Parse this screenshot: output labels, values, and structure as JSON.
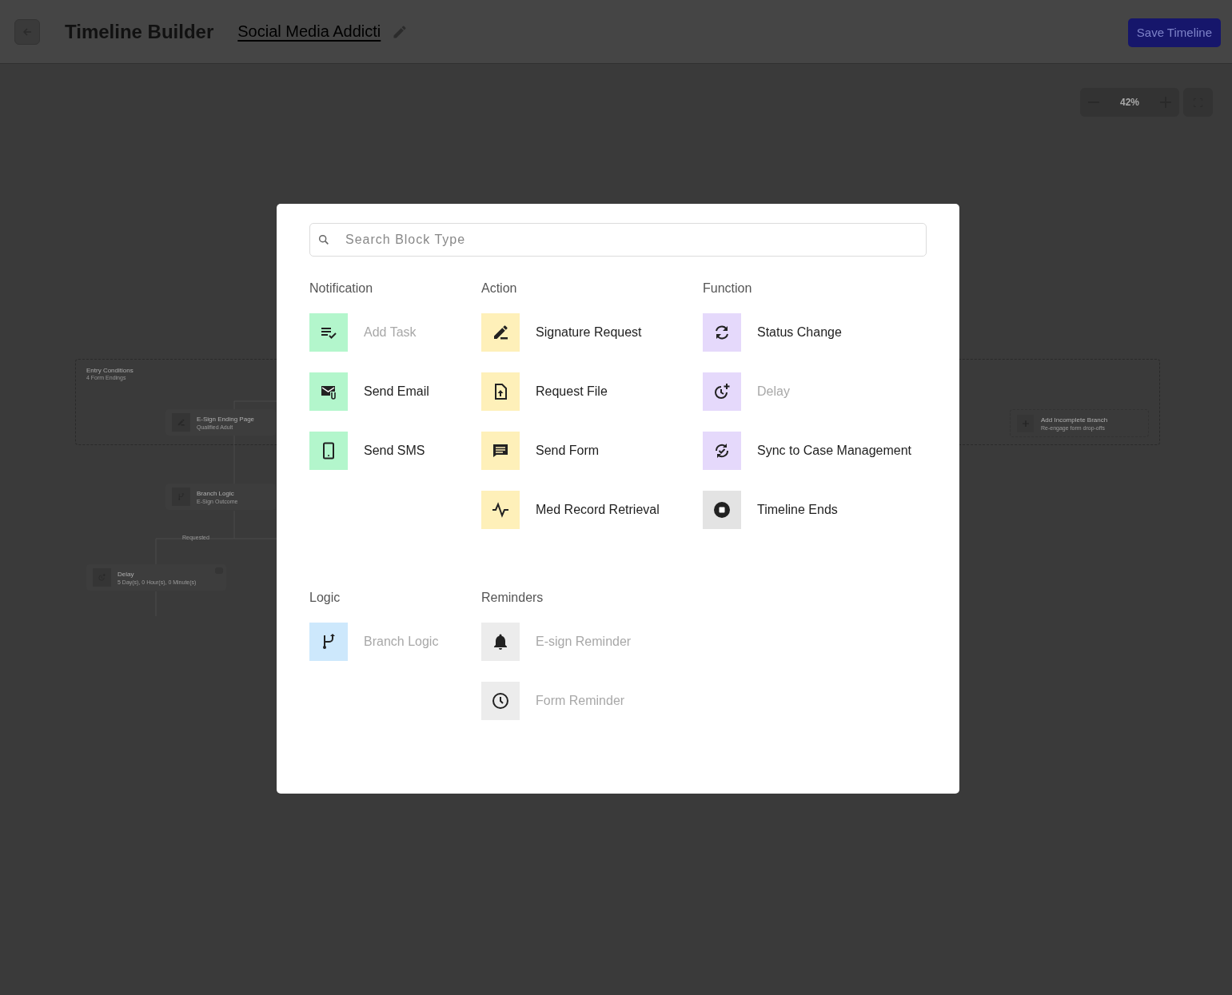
{
  "header": {
    "title": "Timeline Builder",
    "timeline_name": "Social Media Addicti",
    "save_button": "Save Timeline"
  },
  "zoom_controls": {
    "reading": "42%"
  },
  "canvas": {
    "entry_group": {
      "title": "Entry Conditions",
      "subtitle": "4 Form Endings"
    },
    "nodes": [
      {
        "kind": "sign",
        "title": "E-Sign Ending Page",
        "subtitle": "Qualified Adult"
      },
      {
        "kind": "branch",
        "title": "Branch Logic",
        "subtitle": "E-Sign Outcome"
      },
      {
        "kind": "delay",
        "title": "Delay",
        "subtitle": "5 Day(s), 0 Hour(s), 0 Minute(s)"
      }
    ],
    "branch_label": "Requested",
    "add_branch": {
      "title": "Add Incomplete Branch",
      "subtitle": "Re-engage form drop-offs"
    }
  },
  "dialog": {
    "search": {
      "placeholder": "Search Block Type"
    },
    "sections": [
      {
        "title": "Notification",
        "items": [
          {
            "label": "Add Task",
            "kind": "task",
            "disabled": true,
            "color": "#b3f6cc"
          },
          {
            "label": "Send Email",
            "kind": "email",
            "disabled": false,
            "color": "#b3f6cc"
          },
          {
            "label": "Send SMS",
            "kind": "phone",
            "disabled": false,
            "color": "#b3f6cc"
          }
        ]
      },
      {
        "title": "Action",
        "items": [
          {
            "label": "Signature Request",
            "kind": "sign",
            "disabled": false,
            "color": "#fef0b9"
          },
          {
            "label": "Request File",
            "kind": "file",
            "disabled": false,
            "color": "#fef0b9"
          },
          {
            "label": "Send Form",
            "kind": "form",
            "disabled": false,
            "color": "#fef0b9"
          },
          {
            "label": "Med Record Retrieval",
            "kind": "pulse",
            "disabled": false,
            "color": "#fef0b9"
          }
        ]
      },
      {
        "title": "Function",
        "items": [
          {
            "label": "Status Change",
            "kind": "sync",
            "disabled": false,
            "color": "#e5d9fb"
          },
          {
            "label": "Delay",
            "kind": "delay",
            "disabled": true,
            "color": "#e5d9fb"
          },
          {
            "label": "Sync to Case Management",
            "kind": "casesync",
            "disabled": false,
            "color": "#e5d9fb"
          },
          {
            "label": "Timeline Ends",
            "kind": "stop",
            "disabled": false,
            "color": "#e3e3e3"
          }
        ]
      },
      {
        "title": "Logic",
        "items": [
          {
            "label": "Branch Logic",
            "kind": "branch",
            "disabled": true,
            "color": "#cde8fc"
          }
        ]
      },
      {
        "title": "Reminders",
        "items": [
          {
            "label": "E-sign Reminder",
            "kind": "bell",
            "disabled": true,
            "color": "#ececec"
          },
          {
            "label": "Form Reminder",
            "kind": "clock",
            "disabled": true,
            "color": "#ececec"
          }
        ]
      }
    ]
  }
}
